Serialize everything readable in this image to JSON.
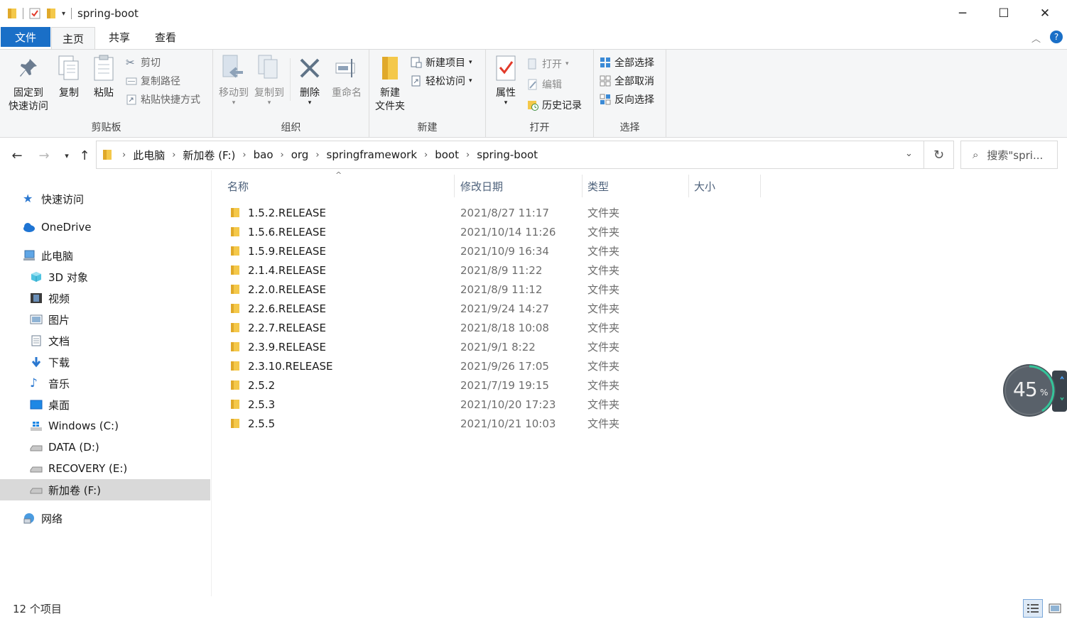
{
  "window": {
    "title": "spring-boot",
    "minimize_glyph": "─",
    "maximize_glyph": "☐",
    "close_glyph": "✕"
  },
  "ribbon_tabs": [
    {
      "label": "文件"
    },
    {
      "label": "主页"
    },
    {
      "label": "共享"
    },
    {
      "label": "查看"
    }
  ],
  "ribbon": {
    "clipboard": {
      "label": "剪贴板",
      "pin_l1": "固定到",
      "pin_l2": "快速访问",
      "copy": "复制",
      "paste": "粘贴",
      "cut": "剪切",
      "copy_path": "复制路径",
      "paste_shortcut": "粘贴快捷方式"
    },
    "organize": {
      "label": "组织",
      "move_to": "移动到",
      "copy_to": "复制到",
      "delete": "删除",
      "rename": "重命名"
    },
    "new": {
      "label": "新建",
      "new_folder_l1": "新建",
      "new_folder_l2": "文件夹",
      "new_item": "新建项目",
      "easy_access": "轻松访问"
    },
    "open": {
      "label": "打开",
      "properties": "属性",
      "open": "打开",
      "edit": "编辑",
      "history": "历史记录"
    },
    "select": {
      "label": "选择",
      "select_all": "全部选择",
      "select_none": "全部取消",
      "invert": "反向选择"
    }
  },
  "address": {
    "crumbs": [
      "此电脑",
      "新加卷 (F:)",
      "bao",
      "org",
      "springframework",
      "boot",
      "spring-boot"
    ],
    "search_placeholder": "搜索\"spri..."
  },
  "nav_pane": {
    "quick_access": "快速访问",
    "onedrive": "OneDrive",
    "this_pc": "此电脑",
    "objects3d": "3D 对象",
    "videos": "视频",
    "pictures": "图片",
    "documents": "文档",
    "downloads": "下载",
    "music": "音乐",
    "desktop": "桌面",
    "drive_c": "Windows (C:)",
    "drive_d": "DATA (D:)",
    "drive_e": "RECOVERY (E:)",
    "drive_f": "新加卷 (F:)",
    "network": "网络"
  },
  "columns": {
    "name": "名称",
    "modified": "修改日期",
    "type": "类型",
    "size": "大小"
  },
  "files": [
    {
      "name": "1.5.2.RELEASE",
      "date": "2021/8/27 11:17",
      "type": "文件夹"
    },
    {
      "name": "1.5.6.RELEASE",
      "date": "2021/10/14 11:26",
      "type": "文件夹"
    },
    {
      "name": "1.5.9.RELEASE",
      "date": "2021/10/9 16:34",
      "type": "文件夹"
    },
    {
      "name": "2.1.4.RELEASE",
      "date": "2021/8/9 11:22",
      "type": "文件夹"
    },
    {
      "name": "2.2.0.RELEASE",
      "date": "2021/8/9 11:12",
      "type": "文件夹"
    },
    {
      "name": "2.2.6.RELEASE",
      "date": "2021/9/24 14:27",
      "type": "文件夹"
    },
    {
      "name": "2.2.7.RELEASE",
      "date": "2021/8/18 10:08",
      "type": "文件夹"
    },
    {
      "name": "2.3.9.RELEASE",
      "date": "2021/9/1 8:22",
      "type": "文件夹"
    },
    {
      "name": "2.3.10.RELEASE",
      "date": "2021/9/26 17:05",
      "type": "文件夹"
    },
    {
      "name": "2.5.2",
      "date": "2021/7/19 19:15",
      "type": "文件夹"
    },
    {
      "name": "2.5.3",
      "date": "2021/10/20 17:23",
      "type": "文件夹"
    },
    {
      "name": "2.5.5",
      "date": "2021/10/21 10:03",
      "type": "文件夹"
    }
  ],
  "status": {
    "item_count": "12 个项目"
  },
  "widget": {
    "percent": "45",
    "unit": "%"
  },
  "colors": {
    "accent": "#1a6fc7",
    "folder": "#f4c84a",
    "selected_nav": "#d9d9d9"
  }
}
